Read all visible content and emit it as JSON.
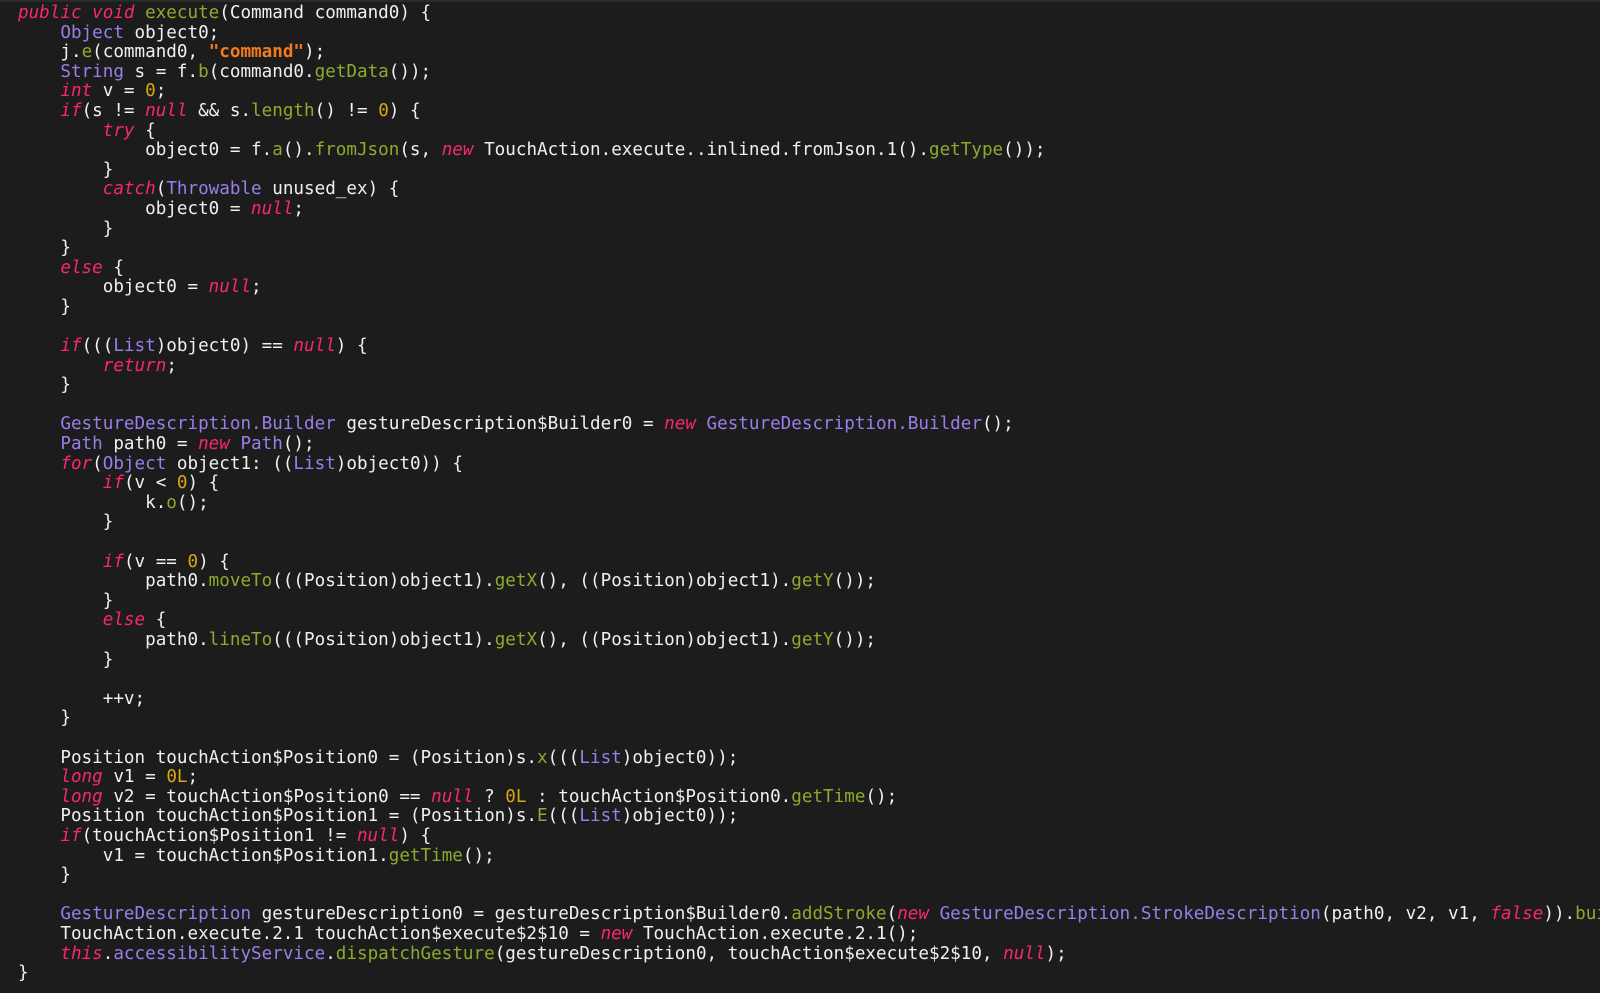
{
  "colors": {
    "background": "#1c1c1c",
    "plain": "#f0f0f0",
    "keyword": "#f92672",
    "type": "#9a7ee9",
    "function": "#8cab2d",
    "string": "#f47a1f",
    "number": "#d8a80d"
  },
  "code": {
    "lines": [
      [
        [
          "kw",
          "public"
        ],
        [
          "p",
          " "
        ],
        [
          "kw",
          "void"
        ],
        [
          "p",
          " "
        ],
        [
          "fn",
          "execute"
        ],
        [
          "p",
          "(Command command0) {"
        ]
      ],
      [
        [
          "p",
          "    "
        ],
        [
          "type",
          "Object"
        ],
        [
          "p",
          " object0;"
        ]
      ],
      [
        [
          "p",
          "    j."
        ],
        [
          "fn",
          "e"
        ],
        [
          "p",
          "(command0, "
        ],
        [
          "str",
          "\"command\""
        ],
        [
          "p",
          ");"
        ]
      ],
      [
        [
          "p",
          "    "
        ],
        [
          "type",
          "String"
        ],
        [
          "p",
          " s = f."
        ],
        [
          "fn",
          "b"
        ],
        [
          "p",
          "(command0."
        ],
        [
          "fn",
          "getData"
        ],
        [
          "p",
          "());"
        ]
      ],
      [
        [
          "p",
          "    "
        ],
        [
          "kw",
          "int"
        ],
        [
          "p",
          " v = "
        ],
        [
          "num",
          "0"
        ],
        [
          "p",
          ";"
        ]
      ],
      [
        [
          "p",
          "    "
        ],
        [
          "kw",
          "if"
        ],
        [
          "p",
          "(s != "
        ],
        [
          "kw",
          "null"
        ],
        [
          "p",
          " && s."
        ],
        [
          "fn",
          "length"
        ],
        [
          "p",
          "() != "
        ],
        [
          "num",
          "0"
        ],
        [
          "p",
          ") {"
        ]
      ],
      [
        [
          "p",
          "        "
        ],
        [
          "kw",
          "try"
        ],
        [
          "p",
          " {"
        ]
      ],
      [
        [
          "p",
          "            object0 = f."
        ],
        [
          "fn",
          "a"
        ],
        [
          "p",
          "()."
        ],
        [
          "fn",
          "fromJson"
        ],
        [
          "p",
          "(s, "
        ],
        [
          "kw",
          "new"
        ],
        [
          "p",
          " TouchAction.execute..inlined.fromJson.1()."
        ],
        [
          "fn",
          "getType"
        ],
        [
          "p",
          "());"
        ]
      ],
      [
        [
          "p",
          "        }"
        ]
      ],
      [
        [
          "p",
          "        "
        ],
        [
          "kw",
          "catch"
        ],
        [
          "p",
          "("
        ],
        [
          "type",
          "Throwable"
        ],
        [
          "p",
          " unused_ex) {"
        ]
      ],
      [
        [
          "p",
          "            object0 = "
        ],
        [
          "kw",
          "null"
        ],
        [
          "p",
          ";"
        ]
      ],
      [
        [
          "p",
          "        }"
        ]
      ],
      [
        [
          "p",
          "    }"
        ]
      ],
      [
        [
          "p",
          "    "
        ],
        [
          "kw",
          "else"
        ],
        [
          "p",
          " {"
        ]
      ],
      [
        [
          "p",
          "        object0 = "
        ],
        [
          "kw",
          "null"
        ],
        [
          "p",
          ";"
        ]
      ],
      [
        [
          "p",
          "    }"
        ]
      ],
      [
        [
          "p",
          ""
        ]
      ],
      [
        [
          "p",
          "    "
        ],
        [
          "kw",
          "if"
        ],
        [
          "p",
          "((("
        ],
        [
          "type",
          "List"
        ],
        [
          "p",
          ")object0) == "
        ],
        [
          "kw",
          "null"
        ],
        [
          "p",
          ") {"
        ]
      ],
      [
        [
          "p",
          "        "
        ],
        [
          "kw",
          "return"
        ],
        [
          "p",
          ";"
        ]
      ],
      [
        [
          "p",
          "    }"
        ]
      ],
      [
        [
          "p",
          ""
        ]
      ],
      [
        [
          "p",
          "    "
        ],
        [
          "type",
          "GestureDescription.Builder"
        ],
        [
          "p",
          " gestureDescription$Builder0 = "
        ],
        [
          "kw",
          "new"
        ],
        [
          "p",
          " "
        ],
        [
          "type",
          "GestureDescription.Builder"
        ],
        [
          "p",
          "();"
        ]
      ],
      [
        [
          "p",
          "    "
        ],
        [
          "type",
          "Path"
        ],
        [
          "p",
          " path0 = "
        ],
        [
          "kw",
          "new"
        ],
        [
          "p",
          " "
        ],
        [
          "type",
          "Path"
        ],
        [
          "p",
          "();"
        ]
      ],
      [
        [
          "p",
          "    "
        ],
        [
          "kw",
          "for"
        ],
        [
          "p",
          "("
        ],
        [
          "type",
          "Object"
        ],
        [
          "p",
          " object1: (("
        ],
        [
          "type",
          "List"
        ],
        [
          "p",
          ")object0)) {"
        ]
      ],
      [
        [
          "p",
          "        "
        ],
        [
          "kw",
          "if"
        ],
        [
          "p",
          "(v < "
        ],
        [
          "num",
          "0"
        ],
        [
          "p",
          ") {"
        ]
      ],
      [
        [
          "p",
          "            k."
        ],
        [
          "fn",
          "o"
        ],
        [
          "p",
          "();"
        ]
      ],
      [
        [
          "p",
          "        }"
        ]
      ],
      [
        [
          "p",
          ""
        ]
      ],
      [
        [
          "p",
          "        "
        ],
        [
          "kw",
          "if"
        ],
        [
          "p",
          "(v == "
        ],
        [
          "num",
          "0"
        ],
        [
          "p",
          ") {"
        ]
      ],
      [
        [
          "p",
          "            path0."
        ],
        [
          "fn",
          "moveTo"
        ],
        [
          "p",
          "(((Position)object1)."
        ],
        [
          "fn",
          "getX"
        ],
        [
          "p",
          "(), ((Position)object1)."
        ],
        [
          "fn",
          "getY"
        ],
        [
          "p",
          "());"
        ]
      ],
      [
        [
          "p",
          "        }"
        ]
      ],
      [
        [
          "p",
          "        "
        ],
        [
          "kw",
          "else"
        ],
        [
          "p",
          " {"
        ]
      ],
      [
        [
          "p",
          "            path0."
        ],
        [
          "fn",
          "lineTo"
        ],
        [
          "p",
          "(((Position)object1)."
        ],
        [
          "fn",
          "getX"
        ],
        [
          "p",
          "(), ((Position)object1)."
        ],
        [
          "fn",
          "getY"
        ],
        [
          "p",
          "());"
        ]
      ],
      [
        [
          "p",
          "        }"
        ]
      ],
      [
        [
          "p",
          ""
        ]
      ],
      [
        [
          "p",
          "        ++v;"
        ]
      ],
      [
        [
          "p",
          "    }"
        ]
      ],
      [
        [
          "p",
          ""
        ]
      ],
      [
        [
          "p",
          "    Position touchAction$Position0 = (Position)s."
        ],
        [
          "fn",
          "x"
        ],
        [
          "p",
          "((("
        ],
        [
          "type",
          "List"
        ],
        [
          "p",
          ")object0));"
        ]
      ],
      [
        [
          "p",
          "    "
        ],
        [
          "kw",
          "long"
        ],
        [
          "p",
          " v1 = "
        ],
        [
          "num",
          "0L"
        ],
        [
          "p",
          ";"
        ]
      ],
      [
        [
          "p",
          "    "
        ],
        [
          "kw",
          "long"
        ],
        [
          "p",
          " v2 = touchAction$Position0 == "
        ],
        [
          "kw",
          "null"
        ],
        [
          "p",
          " ? "
        ],
        [
          "num",
          "0L"
        ],
        [
          "p",
          " : touchAction$Position0."
        ],
        [
          "fn",
          "getTime"
        ],
        [
          "p",
          "();"
        ]
      ],
      [
        [
          "p",
          "    Position touchAction$Position1 = (Position)s."
        ],
        [
          "fn",
          "E"
        ],
        [
          "p",
          "((("
        ],
        [
          "type",
          "List"
        ],
        [
          "p",
          ")object0));"
        ]
      ],
      [
        [
          "p",
          "    "
        ],
        [
          "kw",
          "if"
        ],
        [
          "p",
          "(touchAction$Position1 != "
        ],
        [
          "kw",
          "null"
        ],
        [
          "p",
          ") {"
        ]
      ],
      [
        [
          "p",
          "        v1 = touchAction$Position1."
        ],
        [
          "fn",
          "getTime"
        ],
        [
          "p",
          "();"
        ]
      ],
      [
        [
          "p",
          "    }"
        ]
      ],
      [
        [
          "p",
          ""
        ]
      ],
      [
        [
          "p",
          "    "
        ],
        [
          "type",
          "GestureDescription"
        ],
        [
          "p",
          " gestureDescription0 = gestureDescription$Builder0."
        ],
        [
          "fn",
          "addStroke"
        ],
        [
          "p",
          "("
        ],
        [
          "kw",
          "new"
        ],
        [
          "p",
          " "
        ],
        [
          "type",
          "GestureDescription.StrokeDescription"
        ],
        [
          "p",
          "(path0, v2, v1, "
        ],
        [
          "kw",
          "false"
        ],
        [
          "p",
          "))."
        ],
        [
          "fn",
          "build"
        ],
        [
          "p",
          "();"
        ]
      ],
      [
        [
          "p",
          "    TouchAction.execute.2.1 touchAction$execute$2$10 = "
        ],
        [
          "kw",
          "new"
        ],
        [
          "p",
          " TouchAction.execute.2.1();"
        ]
      ],
      [
        [
          "p",
          "    "
        ],
        [
          "kw",
          "this"
        ],
        [
          "p",
          "."
        ],
        [
          "type",
          "accessibilityService"
        ],
        [
          "p",
          "."
        ],
        [
          "fn",
          "dispatchGesture"
        ],
        [
          "p",
          "(gestureDescription0, touchAction$execute$2$10, "
        ],
        [
          "kw",
          "null"
        ],
        [
          "p",
          ");"
        ]
      ],
      [
        [
          "p",
          "}"
        ]
      ]
    ]
  }
}
